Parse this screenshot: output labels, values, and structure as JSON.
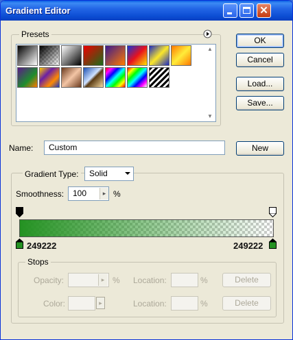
{
  "window": {
    "title": "Gradient Editor"
  },
  "presets": {
    "label": "Presets",
    "swatches": [
      {
        "name": "black-white",
        "css": "linear-gradient(135deg,#000 0%,#fff 100%)"
      },
      {
        "name": "foreground-transparent",
        "css": "linear-gradient(135deg,#000 0%,rgba(0,0,0,0) 100%)"
      },
      {
        "name": "black-white-alt",
        "css": "linear-gradient(135deg,#fff 0%,#000 100%)"
      },
      {
        "name": "red-green",
        "css": "linear-gradient(135deg,#e00 0%,#1a6d1a 100%)"
      },
      {
        "name": "violet-orange",
        "css": "linear-gradient(135deg,#3b1a8f 0%,#ff7a00 100%)"
      },
      {
        "name": "blue-red-yellow",
        "css": "linear-gradient(135deg,#1535d6 0%,#e8121d 50%,#ffe400 100%)"
      },
      {
        "name": "blue-yellow-blue",
        "css": "linear-gradient(135deg,#1c2bc2 0%,#fbe72a 50%,#1c2bc2 100%)"
      },
      {
        "name": "orange-yellow-orange",
        "css": "linear-gradient(135deg,#ff7a00 0%,#ffec3a 50%,#ff7a00 100%)"
      },
      {
        "name": "violet-green-orange",
        "css": "linear-gradient(135deg,#5b1b8a 0%,#1e8d2e 60%,#ff7a00 100%)"
      },
      {
        "name": "yellow-violet-orange-blue",
        "css": "linear-gradient(135deg,#ffcc00 0%,#6a1fa5 35%,#ff8a00 70%,#1e38c8 100%)"
      },
      {
        "name": "copper",
        "css": "linear-gradient(135deg,#6b3a1e 0%,#f3c5a5 50%,#6b3a1e 100%)"
      },
      {
        "name": "chrome",
        "css": "linear-gradient(135deg,#1b4fb3 0%,#cfe2ff 45%,#5a3b14 55%,#f4d9a0 100%)"
      },
      {
        "name": "spectrum",
        "css": "linear-gradient(135deg,#ff0000,#ff00ff,#0000ff,#00ffff,#00ff00,#ffff00,#ff0000)"
      },
      {
        "name": "transparent-rainbow",
        "css": "linear-gradient(135deg,#ff0000,#ffff00,#00ff00,#00ffff,#0000ff,#ff00ff,#fff)"
      },
      {
        "name": "transparent-stripes",
        "css": "repeating-linear-gradient(135deg,#000 0 3px,#fff 3px 6px)"
      }
    ]
  },
  "buttons": {
    "ok": "OK",
    "cancel": "Cancel",
    "load": "Load...",
    "save": "Save...",
    "new": "New"
  },
  "name_field": {
    "label": "Name:",
    "value": "Custom"
  },
  "gradient_type": {
    "label": "Gradient Type:",
    "value": "Solid"
  },
  "smoothness": {
    "label": "Smoothness:",
    "value": "100",
    "unit": "%"
  },
  "gradient": {
    "left_color": "249222",
    "right_color": "249222",
    "color_hex": "#249222",
    "left_opacity_percent": 100,
    "right_opacity_percent": 0
  },
  "stops": {
    "label": "Stops",
    "opacity_label": "Opacity:",
    "opacity_unit": "%",
    "color_label": "Color:",
    "location_label": "Location:",
    "location_unit": "%",
    "delete_label": "Delete"
  }
}
